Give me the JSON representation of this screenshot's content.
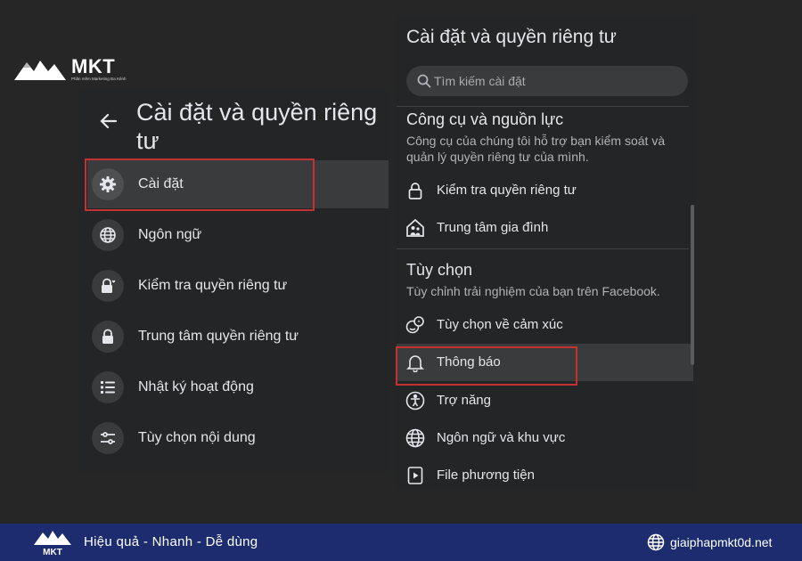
{
  "brand": {
    "name": "MKT",
    "tagline": "Phần mềm Marketing Đa Kênh"
  },
  "left_panel": {
    "title": "Cài đặt và quyền riêng tư",
    "items": [
      {
        "label": "Cài đặt",
        "icon": "gear-icon"
      },
      {
        "label": "Ngôn ngữ",
        "icon": "globe-icon"
      },
      {
        "label": "Kiểm tra quyền riêng tư",
        "icon": "lock-heart-icon"
      },
      {
        "label": "Trung tâm quyền riêng tư",
        "icon": "lock-icon"
      },
      {
        "label": "Nhật ký hoạt động",
        "icon": "list-icon"
      },
      {
        "label": "Tùy chọn nội dung",
        "icon": "sliders-icon"
      }
    ]
  },
  "right_panel": {
    "title": "Cài đặt và quyền riêng tư",
    "search_placeholder": "Tìm kiếm cài đặt",
    "sections": [
      {
        "title": "Công cụ và nguồn lực",
        "description": "Công cụ của chúng tôi hỗ trợ bạn kiểm soát và quản lý quyền riêng tư của mình.",
        "items": [
          {
            "label": "Kiểm tra quyền riêng tư",
            "icon": "lock-icon"
          },
          {
            "label": "Trung tâm gia đình",
            "icon": "family-center-icon"
          }
        ]
      },
      {
        "title": "Tùy chọn",
        "description": "Tùy chỉnh trải nghiệm của bạn trên Facebook.",
        "items": [
          {
            "label": "Tùy chọn về cảm xúc",
            "icon": "reactions-icon"
          },
          {
            "label": "Thông báo",
            "icon": "bell-icon"
          },
          {
            "label": "Trợ năng",
            "icon": "accessibility-icon"
          },
          {
            "label": "Ngôn ngữ và khu vực",
            "icon": "globe-icon"
          },
          {
            "label": "File phương tiện",
            "icon": "media-icon"
          }
        ]
      }
    ]
  },
  "footer": {
    "slogan": "Hiệu quả - Nhanh - Dễ dùng",
    "website": "giaiphapmkt0d.net"
  },
  "colors": {
    "background": "#262626",
    "panel": "#242526",
    "highlight": "#3a3b3c",
    "annotation_red": "#c43131",
    "footer": "#1c2c6e"
  }
}
